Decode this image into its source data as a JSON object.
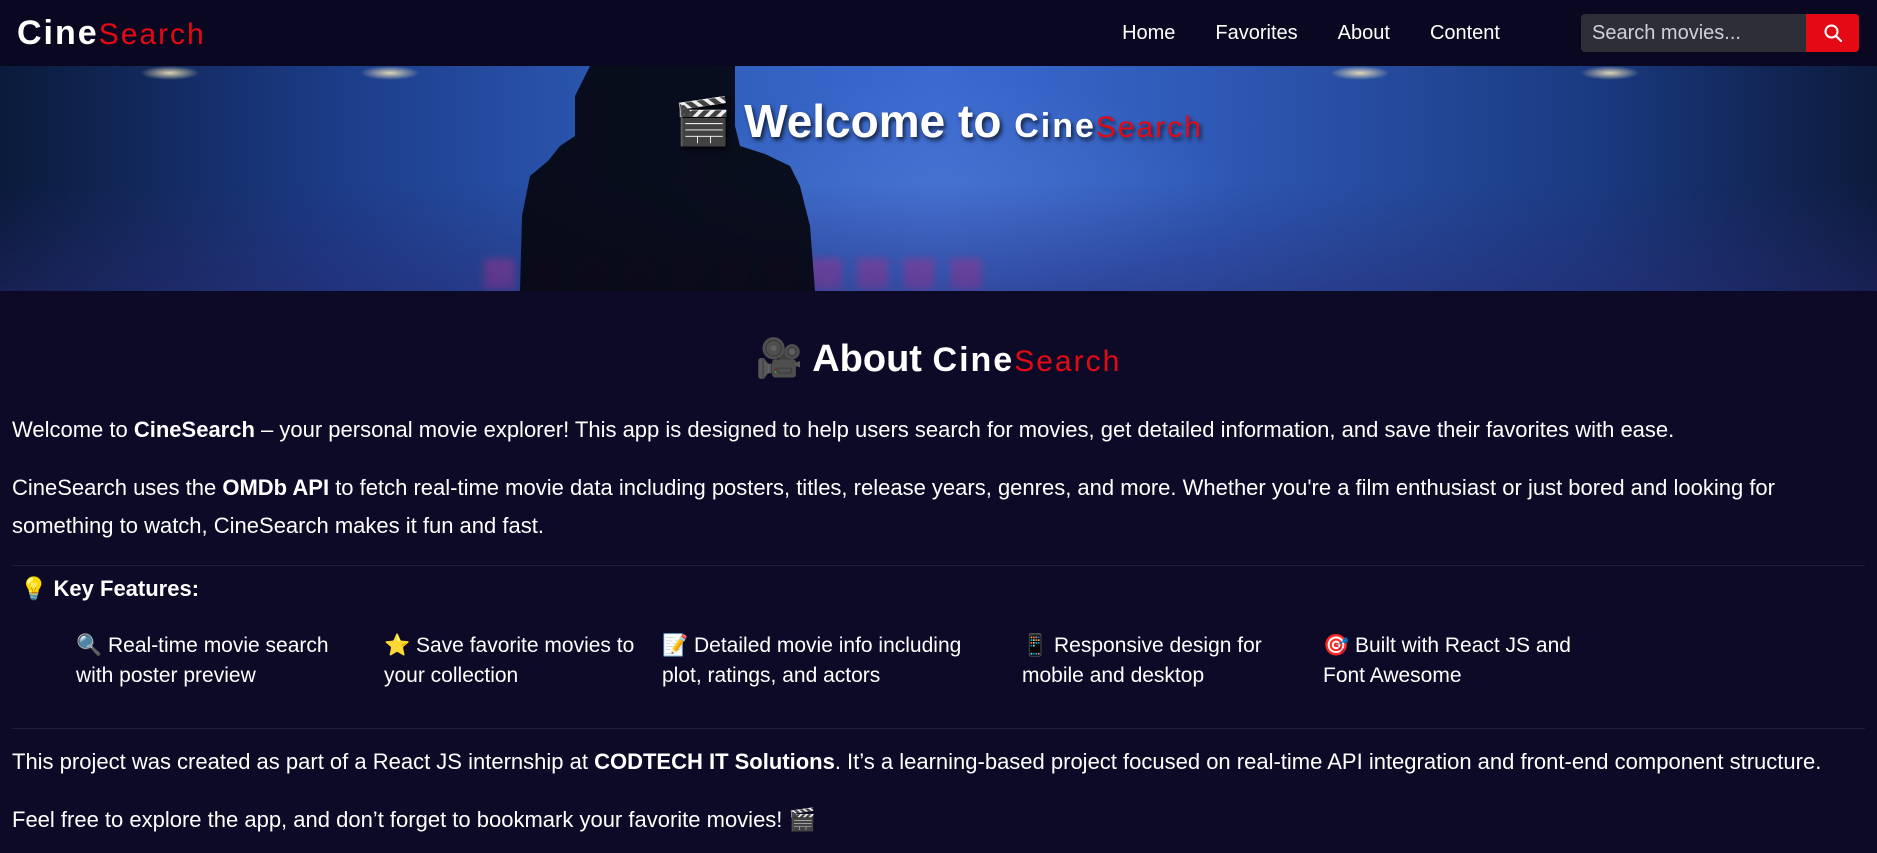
{
  "nav": {
    "brand_cine": "Cine",
    "brand_search": "Search",
    "links": [
      "Home",
      "Favorites",
      "About",
      "Content"
    ],
    "search_placeholder": "Search movies..."
  },
  "hero": {
    "emoji": "🎬",
    "title_prefix": "Welcome to",
    "brand_cine": "Cine",
    "brand_search": "Search"
  },
  "about": {
    "emoji": "🎥",
    "title_prefix": "About",
    "brand_cine": "Cine",
    "brand_search": "Search",
    "p1": {
      "a": "Welcome to ",
      "b": "CineSearch",
      "c": " – your personal movie explorer! This app is designed to help users search for movies, get detailed information, and save their favorites with ease."
    },
    "p2": {
      "a": "CineSearch uses the ",
      "b": "OMDb API",
      "c": " to fetch real-time movie data including posters, titles, release years, genres, and more. Whether you're a film enthusiast or just bored and looking for something to watch, CineSearch makes it fun and fast."
    },
    "features_emoji": "💡",
    "features_title": "Key Features:",
    "features": [
      {
        "emoji": "🔍",
        "text": "Real-time movie search with poster preview"
      },
      {
        "emoji": "⭐",
        "text": "Save favorite movies to your collection"
      },
      {
        "emoji": "📝",
        "text": "Detailed movie info including plot, ratings, and actors"
      },
      {
        "emoji": "📱",
        "text": "Responsive design for mobile and desktop"
      },
      {
        "emoji": "🎯",
        "text": "Built with React JS and Font Awesome"
      }
    ],
    "p3": {
      "a": "This project was created as part of a React JS internship at ",
      "b": "CODTECH IT Solutions",
      "c": ". It’s a learning-based project focused on real-time API integration and front-end component structure."
    },
    "p4": {
      "a": "Feel free to explore the app, and don’t forget to bookmark your favorite movies! ",
      "emoji": "🎬"
    }
  },
  "colors": {
    "background": "#0c0a26",
    "navbar": "#0a0821",
    "accent_red": "#e50914"
  },
  "icons": {
    "search_button": "search-icon"
  }
}
